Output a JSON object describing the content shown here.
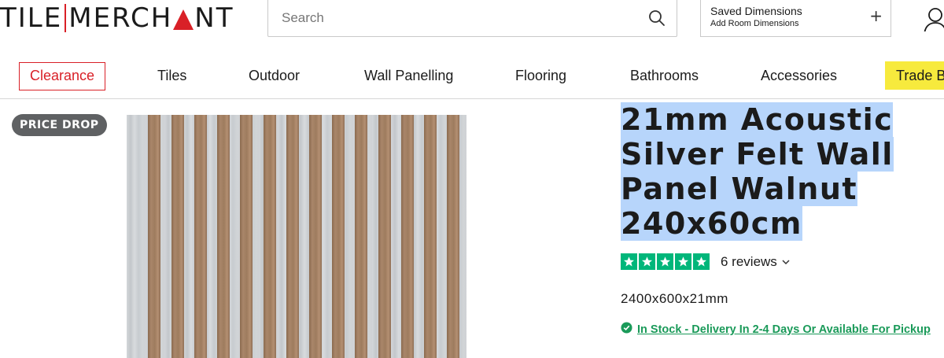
{
  "header": {
    "logo_left": "TILE",
    "logo_mid": "MERCH",
    "logo_a": "A",
    "logo_right": "NT",
    "search_placeholder": "Search",
    "saved_title": "Saved Dimensions",
    "saved_subtitle": "Add Room Dimensions",
    "saved_plus": "+"
  },
  "nav": {
    "items": [
      "Clearance",
      "Tiles",
      "Outdoor",
      "Wall Panelling",
      "Flooring",
      "Bathrooms",
      "Accessories",
      "Trade B"
    ]
  },
  "product": {
    "badge": "PRICE DROP",
    "title_lines": [
      "21mm Acoustic",
      "Silver Felt Wall",
      "Panel Walnut",
      "240x60cm"
    ],
    "rating_stars": 5,
    "reviews": "6 reviews",
    "dimensions": "2400x600x21mm",
    "stock": "In Stock - Delivery In 2-4 Days Or Available For Pickup"
  },
  "colors": {
    "brand_red": "#d92027",
    "trade_yellow": "#f7ea3d",
    "trustpilot_green": "#00b67a",
    "stock_green": "#1a9a59",
    "selection_blue": "#b7d5fb"
  },
  "icons": [
    "search-icon",
    "plus-icon",
    "user-icon",
    "star-icon",
    "chevron-down-icon",
    "check-circle-icon"
  ]
}
